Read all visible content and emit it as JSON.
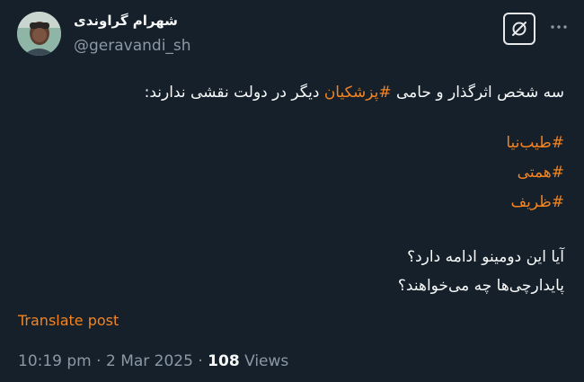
{
  "author": {
    "name": "شهرام گراوندی",
    "handle": "@geravandi_sh"
  },
  "body": {
    "intro_before": "سه شخص اثرگذار و حامی ",
    "intro_hashtag": "#پزشکیان",
    "intro_after": " دیگر در دولت نقشی ندارند:",
    "hashtags": [
      "#طیب‌نیا",
      "#همتی",
      "#ظریف"
    ],
    "question_1": "آیا این دومینو ادامه دارد؟",
    "question_2": "پایدارچی‌ها چه می‌خواهند؟"
  },
  "translate_label": "Translate post",
  "meta": {
    "time": "10:19 pm",
    "separator": "·",
    "date": "2 Mar 2025",
    "views_count": "108",
    "views_label": "Views"
  },
  "icons": {
    "grok": "grok-icon",
    "more": "more-icon"
  },
  "colors": {
    "background": "#15202b",
    "accent": "#f5841f",
    "secondary_text": "#8b98a5",
    "primary_text": "#f7f9f9"
  }
}
